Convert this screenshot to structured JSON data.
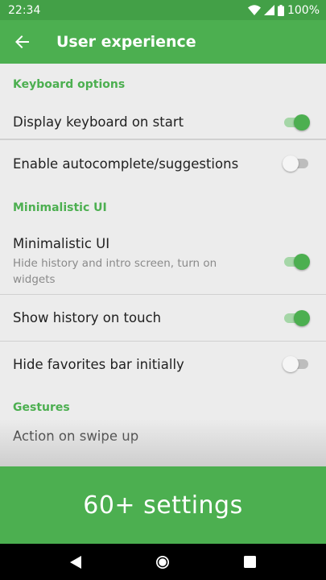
{
  "status_bar": {
    "time": "22:34",
    "battery": "100%"
  },
  "app_bar": {
    "title": "User experience"
  },
  "sections": [
    {
      "header": "Keyboard options",
      "items": [
        {
          "title": "Display keyboard on start",
          "summary": "",
          "checked": true
        },
        {
          "title": "Enable autocomplete/suggestions",
          "summary": "",
          "checked": false
        }
      ]
    },
    {
      "header": "Minimalistic UI",
      "items": [
        {
          "title": "Minimalistic UI",
          "summary": "Hide history and intro screen, turn on widgets",
          "checked": true
        },
        {
          "title": "Show history on touch",
          "summary": "",
          "checked": true
        },
        {
          "title": "Hide favorites bar initially",
          "summary": "",
          "checked": false
        }
      ]
    },
    {
      "header": "Gestures",
      "items": [
        {
          "title": "Action on swipe up",
          "summary": ""
        }
      ]
    }
  ],
  "promo": {
    "text": "60+ settings"
  },
  "colors": {
    "accent": "#4caf50",
    "status_bar": "#43a047",
    "background": "#ececec"
  },
  "nav_bar": {
    "icons": [
      "back-triangle-icon",
      "home-circle-icon",
      "recents-square-icon"
    ]
  }
}
